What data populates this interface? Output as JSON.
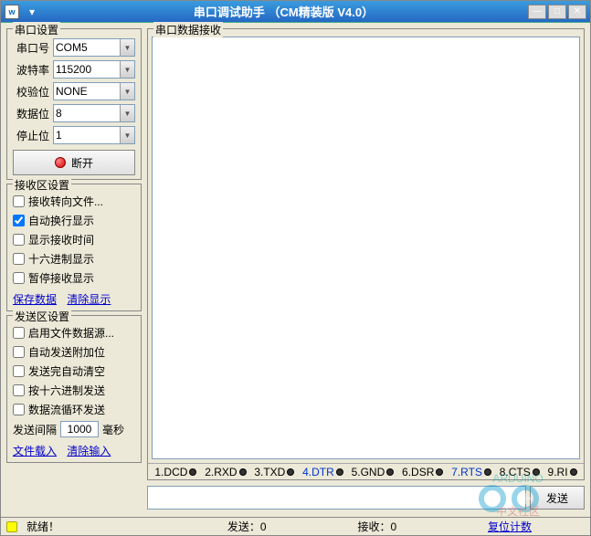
{
  "window": {
    "title": "串口调试助手 （CM精装版 V4.0）"
  },
  "serial": {
    "group_title": "串口设置",
    "port_label": "串口号",
    "port_value": "COM5",
    "baud_label": "波特率",
    "baud_value": "115200",
    "parity_label": "校验位",
    "parity_value": "NONE",
    "databits_label": "数据位",
    "databits_value": "8",
    "stopbits_label": "停止位",
    "stopbits_value": "1",
    "disconnect_label": "断开"
  },
  "recv_settings": {
    "group_title": "接收区设置",
    "redirect_file": "接收转向文件...",
    "auto_wrap": "自动换行显示",
    "show_time": "显示接收时间",
    "hex_display": "十六进制显示",
    "pause_recv": "暂停接收显示",
    "save_link": "保存数据",
    "clear_link": "清除显示"
  },
  "send_settings": {
    "group_title": "发送区设置",
    "file_source": "启用文件数据源...",
    "auto_append": "自动发送附加位",
    "auto_clear": "发送完自动清空",
    "hex_send": "按十六进制发送",
    "loop_send": "数据流循环发送",
    "interval_label": "发送间隔",
    "interval_value": "1000",
    "interval_unit": "毫秒",
    "file_load_link": "文件载入",
    "clear_input_link": "清除输入"
  },
  "recv_area": {
    "group_title": "串口数据接收"
  },
  "signals": {
    "dcd": "1.DCD",
    "rxd": "2.RXD",
    "txd": "3.TXD",
    "dtr": "4.DTR",
    "gnd": "5.GND",
    "dsr": "6.DSR",
    "rts": "7.RTS",
    "cts": "8.CTS",
    "ri": "9.RI"
  },
  "send": {
    "button_label": "发送"
  },
  "statusbar": {
    "ready": "就绪！",
    "send_count": "发送：0",
    "recv_count": "接收：0",
    "reset_count": "复位计数"
  }
}
